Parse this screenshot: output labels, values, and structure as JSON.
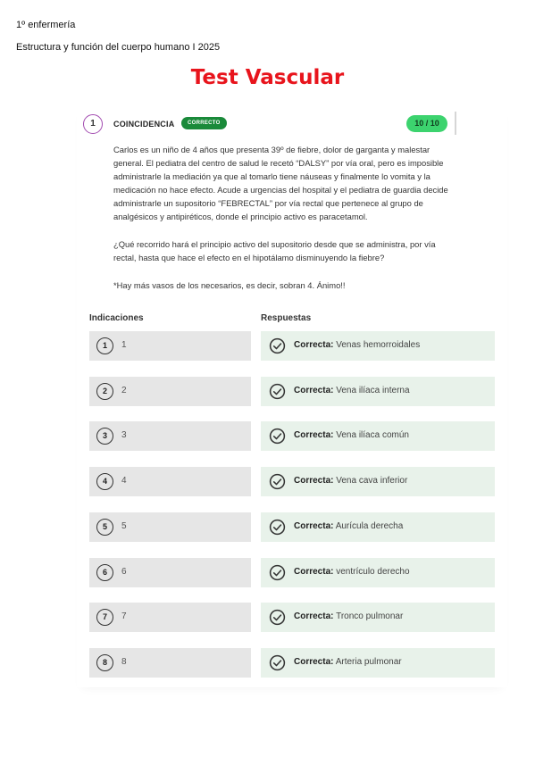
{
  "header": {
    "line1": "1º enfermería",
    "line2": "Estructura y función del cuerpo humano I 2025"
  },
  "title": "Test Vascular",
  "question": {
    "number": "1",
    "type": "COINCIDENCIA",
    "status": "CORRECTO",
    "score": "10 / 10",
    "paragraph1": "Carlos es un niño de 4 años que presenta 39º de fiebre, dolor de garganta y malestar general. El pediatra del centro de salud le recetó “DALSY” por vía oral, pero es imposible administrarle la mediación ya que al tomarlo tiene náuseas y finalmente lo vomita y la medicación no hace efecto. Acude a urgencias del hospital y el pediatra de guardia decide administrarle un supositorio “FEBRECTAL” por vía rectal que pertenece al grupo de analgésicos y antipiréticos, donde el principio activo es paracetamol.",
    "paragraph2": "¿Qué recorrido hará el principio activo del supositorio desde que se administra, por vía rectal, hasta que hace el efecto en el hipotálamo disminuyendo la fiebre?",
    "paragraph3": "*Hay más vasos de los necesarios, es decir, sobran 4. Ánimo!!"
  },
  "columns": {
    "indications": "Indicaciones",
    "answers": "Respuestas"
  },
  "correct_prefix": "Correcta:",
  "rows": [
    {
      "num": "1",
      "indication": "1",
      "answer": "Venas hemorroidales"
    },
    {
      "num": "2",
      "indication": "2",
      "answer": "Vena ilíaca interna"
    },
    {
      "num": "3",
      "indication": "3",
      "answer": "Vena ilíaca común"
    },
    {
      "num": "4",
      "indication": "4",
      "answer": "Vena cava inferior"
    },
    {
      "num": "5",
      "indication": "5",
      "answer": "Aurícula derecha"
    },
    {
      "num": "6",
      "indication": "6",
      "answer": "ventrículo derecho"
    },
    {
      "num": "7",
      "indication": "7",
      "answer": "Tronco pulmonar"
    },
    {
      "num": "8",
      "indication": "8",
      "answer": "Arteria pulmonar"
    }
  ],
  "colors": {
    "title": "#e8141c",
    "badge": "#1a8a3a",
    "score": "#3cd36e",
    "answer_bg": "#e8f2ea",
    "indication_bg": "#e6e6e6"
  }
}
